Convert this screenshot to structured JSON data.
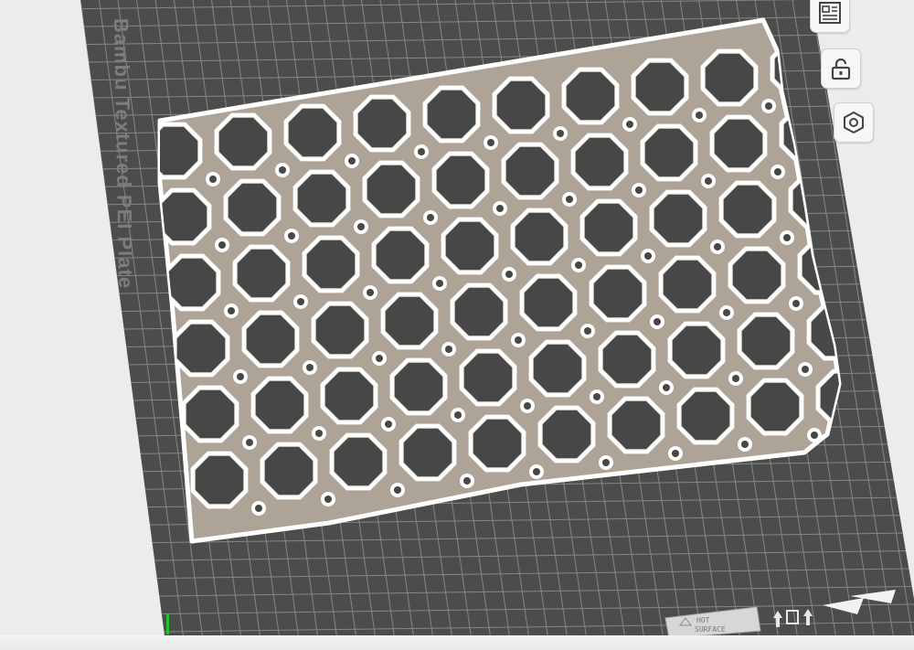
{
  "viewport": {
    "plate_label": "Bambu Textured PEI Plate",
    "hot_surface_label_line1": "HOT",
    "hot_surface_label_line2": "SURFACE"
  },
  "toolbar": {
    "arrange_icon": "arrange-layout-icon",
    "lock_icon": "unlock-padlock-icon",
    "orient_icon": "hex-nut-icon"
  },
  "colors": {
    "plate": "#4c4d4b",
    "grid_line": "#868785",
    "part": "#ada497",
    "part_outline": "#ffffff",
    "hole": "#474845",
    "background": "#ececec"
  }
}
